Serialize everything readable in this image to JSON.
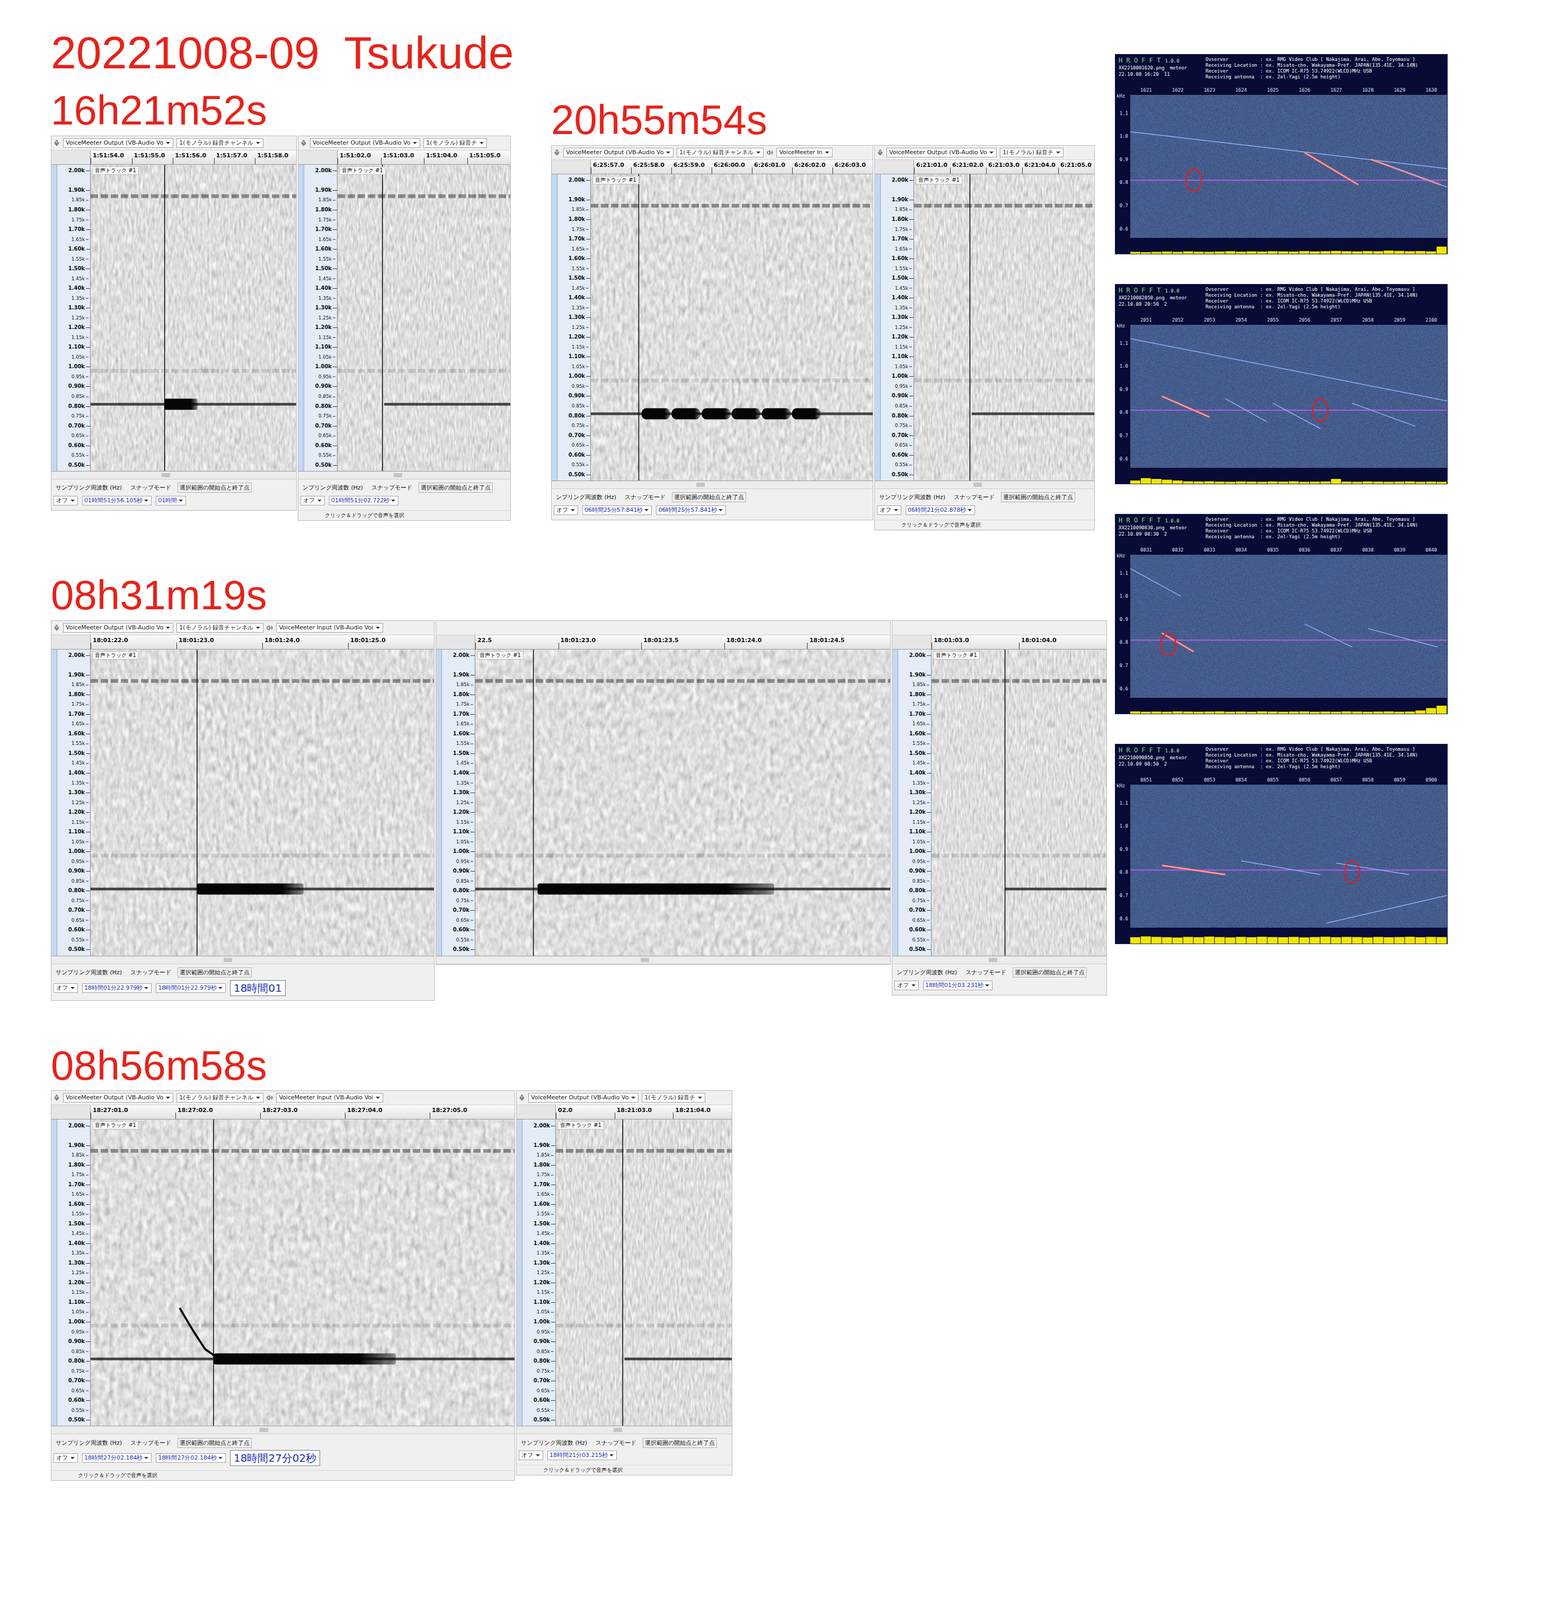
{
  "title": "20221008-09  Tsukude",
  "track_label": "音声トラック #1",
  "freq_ticks": [
    {
      "label": "2.00k",
      "kind": "major"
    },
    {
      "label": "1.90k",
      "kind": "major"
    },
    {
      "label": "1.85k",
      "kind": "minor"
    },
    {
      "label": "1.80k",
      "kind": "major"
    },
    {
      "label": "1.75k",
      "kind": "minor"
    },
    {
      "label": "1.70k",
      "kind": "major"
    },
    {
      "label": "1.65k",
      "kind": "minor"
    },
    {
      "label": "1.60k",
      "kind": "major"
    },
    {
      "label": "1.55k",
      "kind": "minor"
    },
    {
      "label": "1.50k",
      "kind": "major"
    },
    {
      "label": "1.45k",
      "kind": "minor"
    },
    {
      "label": "1.40k",
      "kind": "major"
    },
    {
      "label": "1.35k",
      "kind": "minor"
    },
    {
      "label": "1.30k",
      "kind": "major"
    },
    {
      "label": "1.25k",
      "kind": "minor"
    },
    {
      "label": "1.20k",
      "kind": "major"
    },
    {
      "label": "1.15k",
      "kind": "minor"
    },
    {
      "label": "1.10k",
      "kind": "major"
    },
    {
      "label": "1.05k",
      "kind": "minor"
    },
    {
      "label": "1.00k",
      "kind": "major"
    },
    {
      "label": "0.95k",
      "kind": "minor"
    },
    {
      "label": "0.90k",
      "kind": "major"
    },
    {
      "label": "0.85k",
      "kind": "minor"
    },
    {
      "label": "0.80k",
      "kind": "major"
    },
    {
      "label": "0.75k",
      "kind": "minor"
    },
    {
      "label": "0.70k",
      "kind": "major"
    },
    {
      "label": "0.65k",
      "kind": "minor"
    },
    {
      "label": "0.60k",
      "kind": "major"
    },
    {
      "label": "0.55k",
      "kind": "minor"
    },
    {
      "label": "0.50k",
      "kind": "major"
    }
  ],
  "bands": [
    {
      "freq": 1.87,
      "level": 0.45
    },
    {
      "freq": 0.98,
      "level": 0.15
    }
  ],
  "sections": [
    {
      "label": "16h21m52s",
      "panels": [
        {
          "toolbar": {
            "input": "VoiceMeeter Output (VB-Audio Vo",
            "channel": "1(モノラル) 録音チャンネル"
          },
          "ticks": [
            "1:51:54.0",
            "1:51:55.0",
            "1:51:56.0",
            "1:51:57.0",
            "1:51:58.0"
          ],
          "playhead": 0.36,
          "carrier_start": 0,
          "echoes": [
            {
              "start": 0.36,
              "end": 0.52,
              "freq": 0.81,
              "pulsed": false
            }
          ],
          "selection": {
            "labels": [
              "サンプリング周波数 (Hz)",
              "スナップモード",
              "選択範囲の開始点と終了点"
            ],
            "snap": "オフ",
            "fields": [
              "01時間51分56.105秒",
              "01時間"
            ]
          }
        },
        {
          "toolbar": {
            "input": "VoiceMeeter Output (VB-Audio Vo",
            "channel": "1(モノラル) 録音チ"
          },
          "ticks": [
            "1:51:02.0",
            "1:51:03.0",
            "1:51:04.0",
            "1:51:05.0"
          ],
          "playhead": 0.26,
          "carrier_start": 0.27,
          "echoes": [],
          "selection": {
            "labels": [
              "ンプリング周波数 (Hz)",
              "スナップモード",
              "選択範囲の開始点と終了点"
            ],
            "snap": "オフ",
            "fields": [
              "01時間51分02.722秒"
            ]
          },
          "status": "クリック＆ドラッグで音声を選択"
        }
      ]
    },
    {
      "label": "20h55m54s",
      "panels": [
        {
          "toolbar": {
            "input": "VoiceMeeter Output (VB-Audio Vo",
            "channel": "1(モノラル) 録音チャンネル",
            "output": "VoiceMeeter In"
          },
          "ticks": [
            "6:25:57.0",
            "6:25:58.0",
            "6:25:59.0",
            "6:26:00.0",
            "6:26:01.0",
            "6:26:02.0",
            "6:26:03.0"
          ],
          "playhead": 0.17,
          "carrier_start": 0,
          "echoes": [
            {
              "start": 0.18,
              "end": 0.82,
              "freq": 0.81,
              "pulsed": true
            }
          ],
          "selection": {
            "labels": [
              "ンプリング周波数 (Hz)",
              "スナップモード",
              "選択範囲の開始点と終了点"
            ],
            "snap": "オフ",
            "fields": [
              "06時間25分57.841秒",
              "06時間25分57.841秒"
            ]
          }
        },
        {
          "toolbar": {
            "input": "VoiceMeeter Output (VB-Audio Vo",
            "channel": "1(モノラル) 録音チ"
          },
          "ticks": [
            "6:21:01.0",
            "6:21:02.0",
            "6:21:03.0",
            "6:21:04.0",
            "6:21:05.0"
          ],
          "playhead": 0.31,
          "carrier_start": 0.32,
          "echoes": [],
          "selection": {
            "labels": [
              "サンプリング周波数 (Hz)",
              "スナップモード",
              "選択範囲の開始点と終了点"
            ],
            "snap": "オフ",
            "fields": [
              "06時間21分02.878秒"
            ]
          },
          "status": "クリック＆ドラッグで音声を選択"
        }
      ]
    },
    {
      "label": "08h31m19s",
      "panels": [
        {
          "toolbar": {
            "input": "VoiceMeeter Output (VB-Audio Vo",
            "channel": "1(モノラル) 録音チャンネル",
            "output": "VoiceMeeter Input (VB-Audio Voi"
          },
          "ticks": [
            "18:01:22.0",
            "18:01:23.0",
            "18:01:24.0",
            "18:01:25.0"
          ],
          "playhead": 0.31,
          "carrier_start": 0,
          "echoes": [
            {
              "start": 0.31,
              "end": 0.62,
              "freq": 0.81,
              "pulsed": false
            }
          ],
          "selection": {
            "labels": [
              "サンプリング周波数 (Hz)",
              "スナップモード",
              "選択範囲の開始点と終了点"
            ],
            "snap": "オフ",
            "fields": [
              "18時間01分22.979秒",
              "18時間01分22.979秒"
            ],
            "big": "18時間01"
          }
        },
        {
          "toolbar": {},
          "ticks": [
            "22.5",
            "18:01:23.0",
            "18:01:23.5",
            "18:01:24.0",
            "18:01:24.5"
          ],
          "playhead": 0.14,
          "carrier_start": 0,
          "echoes": [
            {
              "start": 0.15,
              "end": 0.72,
              "freq": 0.81,
              "pulsed": false
            }
          ]
        },
        {
          "toolbar": {},
          "ticks": [
            "18:01:03.0",
            "18:01:04.0"
          ],
          "playhead": 0.42,
          "carrier_start": 0.42,
          "echoes": [],
          "selection": {
            "labels": [
              "ンプリング周波数 (Hz)",
              "スナップモード",
              "選択範囲の開始点と終了点"
            ],
            "snap": "オフ",
            "fields": [
              "18時間01分03.231秒"
            ]
          }
        }
      ]
    },
    {
      "label": "08h56m58s",
      "panels": [
        {
          "toolbar": {
            "input": "VoiceMeeter Output (VB-Audio Vo",
            "channel": "1(モノラル) 録音チャンネル",
            "output": "VoiceMeeter Input (VB-Audio Voi"
          },
          "ticks": [
            "18:27:01.0",
            "18:27:02.0",
            "18:27:03.0",
            "18:27:04.0",
            "18:27:05.0"
          ],
          "playhead": 0.29,
          "carrier_start": 0,
          "echoes": [
            {
              "start": 0.29,
              "end": 0.72,
              "freq": 0.81,
              "pulsed": false
            }
          ],
          "curve": [
            [
              0.21,
              1.07
            ],
            [
              0.24,
              0.96
            ],
            [
              0.27,
              0.86
            ],
            [
              0.3,
              0.815
            ]
          ],
          "selection": {
            "labels": [
              "サンプリング周波数 (Hz)",
              "スナップモード",
              "選択範囲の開始点と終了点"
            ],
            "snap": "オフ",
            "fields": [
              "18時間27分02.184秒",
              "18時間27分02.184秒"
            ],
            "big": "18時間27分02秒"
          },
          "status": "クリック＆ドラッグで音声を選択"
        },
        {
          "toolbar": {
            "input": "VoiceMeeter Output (VB-Audio Vo",
            "channel": "1(モノラル) 録音チ"
          },
          "ticks": [
            "02.0",
            "18:21:03.0",
            "18:21:04.0"
          ],
          "playhead": 0.38,
          "carrier_start": 0.39,
          "echoes": [],
          "selection": {
            "labels": [
              "サンプリング周波数 (Hz)",
              "スナップモード",
              "選択範囲の開始点と終了点"
            ],
            "snap": "オフ",
            "fields": [
              "18時間21分03.215秒"
            ]
          },
          "status": "クリック＆ドラッグで音声を選択"
        }
      ]
    }
  ],
  "hrofft": {
    "brand": "H R O F F T",
    "version": "1.0.0",
    "count_label": "meteor",
    "unit": "kHz",
    "carrier": 0.81,
    "header": [
      "Ovserver           : ex. RMG Video Club [ Nakajima, Arai, Abe, Toyomasu ]",
      "Receiving Location : ex. Misato-cho, Wakayama-Pref. JAPAN(135.41E, 34.14N)",
      "Receiver           : ex. ICOM IC-R75 53.74922(WLCD)MHz USB",
      "Receiving antenna  : ex. 2el-Yagi (2.5m height)"
    ],
    "y_ticks": [
      "1.1",
      "1.0",
      "0.9",
      "0.8",
      "0.7",
      "0.6"
    ],
    "images": [
      {
        "file": "XX2210081620.png",
        "count": "11",
        "datetime": "22.10.08 16:20",
        "ticks": [
          "1621",
          "1622",
          "1623",
          "1624",
          "1625",
          "1626",
          "1627",
          "1628",
          "1629",
          "1630"
        ],
        "marker": [
          0.2,
          0.81
        ],
        "lines": [
          {
            "kind": "trace",
            "points": [
              0.0,
              1.02,
              1.0,
              0.86
            ]
          },
          {
            "kind": "echo",
            "points": [
              0.55,
              0.93,
              0.72,
              0.79
            ]
          },
          {
            "kind": "echo",
            "points": [
              0.76,
              0.9,
              0.98,
              0.79
            ]
          },
          {
            "kind": "trace",
            "points": [
              0.82,
              0.87,
              1.0,
              0.78
            ]
          }
        ],
        "histogram": [
          0.12,
          0.1,
          0.12,
          0.14,
          0.12,
          0.15,
          0.13,
          0.12,
          0.14,
          0.16,
          0.13,
          0.15,
          0.14,
          0.16,
          0.15,
          0.14,
          0.17,
          0.15,
          0.16,
          0.18,
          0.16,
          0.15,
          0.17,
          0.16,
          0.2,
          0.18,
          0.16,
          0.17,
          0.15,
          0.45
        ]
      },
      {
        "file": "XX2210082050.png",
        "count": "2",
        "datetime": "22.10.08 20:50",
        "ticks": [
          "2051",
          "2052",
          "2053",
          "2054",
          "2055",
          "2056",
          "2057",
          "2058",
          "2059",
          "2100"
        ],
        "marker": [
          0.6,
          0.81
        ],
        "lines": [
          {
            "kind": "trace",
            "points": [
              0.0,
              1.12,
              1.0,
              0.85
            ]
          },
          {
            "kind": "echo",
            "points": [
              0.1,
              0.87,
              0.25,
              0.78
            ]
          },
          {
            "kind": "trace",
            "points": [
              0.3,
              0.86,
              0.43,
              0.76
            ]
          },
          {
            "kind": "trace",
            "points": [
              0.45,
              0.84,
              0.6,
              0.73
            ]
          },
          {
            "kind": "trace",
            "points": [
              0.7,
              0.84,
              0.9,
              0.74
            ]
          }
        ],
        "histogram": [
          0.2,
          0.35,
          0.3,
          0.25,
          0.2,
          0.15,
          0.14,
          0.15,
          0.13,
          0.12,
          0.14,
          0.13,
          0.12,
          0.14,
          0.13,
          0.15,
          0.12,
          0.13,
          0.14,
          0.3,
          0.13,
          0.12,
          0.14,
          0.13,
          0.12,
          0.13,
          0.14,
          0.12,
          0.13,
          0.12
        ]
      },
      {
        "file": "XX2210090830.png",
        "count": "2",
        "datetime": "22.10.09 08:30",
        "ticks": [
          "0831",
          "0832",
          "0833",
          "0834",
          "0835",
          "0836",
          "0837",
          "0838",
          "0839",
          "0840"
        ],
        "marker": [
          0.12,
          0.79
        ],
        "lines": [
          {
            "kind": "trace",
            "points": [
              0.0,
              1.12,
              0.16,
              1.0
            ]
          },
          {
            "kind": "echo",
            "points": [
              0.1,
              0.84,
              0.2,
              0.76
            ]
          },
          {
            "kind": "trace",
            "points": [
              0.55,
              0.88,
              0.7,
              0.78
            ]
          },
          {
            "kind": "trace",
            "points": [
              0.75,
              0.86,
              0.97,
              0.78
            ]
          }
        ],
        "histogram": [
          0.14,
          0.12,
          0.13,
          0.12,
          0.14,
          0.13,
          0.12,
          0.13,
          0.14,
          0.12,
          0.13,
          0.12,
          0.14,
          0.13,
          0.12,
          0.13,
          0.14,
          0.12,
          0.13,
          0.12,
          0.14,
          0.13,
          0.12,
          0.13,
          0.14,
          0.12,
          0.13,
          0.2,
          0.35,
          0.5
        ]
      },
      {
        "file": "XX2210090850.png",
        "count": "2",
        "datetime": "22.10.09 08:50",
        "ticks": [
          "0851",
          "0852",
          "0853",
          "0854",
          "0855",
          "0856",
          "0857",
          "0858",
          "0859",
          "0900"
        ],
        "marker": [
          0.7,
          0.8
        ],
        "lines": [
          {
            "kind": "echo",
            "points": [
              0.1,
              0.83,
              0.3,
              0.79
            ]
          },
          {
            "kind": "trace",
            "points": [
              0.35,
              0.85,
              0.6,
              0.79
            ]
          },
          {
            "kind": "trace",
            "points": [
              0.65,
              0.84,
              0.88,
              0.79
            ]
          },
          {
            "kind": "trace",
            "points": [
              0.62,
              0.58,
              1.0,
              0.7
            ]
          }
        ],
        "histogram": [
          0.4,
          0.45,
          0.42,
          0.4,
          0.38,
          0.42,
          0.4,
          0.44,
          0.41,
          0.39,
          0.42,
          0.4,
          0.43,
          0.41,
          0.4,
          0.42,
          0.39,
          0.41,
          0.43,
          0.4,
          0.42,
          0.41,
          0.39,
          0.42,
          0.4,
          0.41,
          0.43,
          0.4,
          0.42,
          0.41
        ]
      }
    ]
  }
}
